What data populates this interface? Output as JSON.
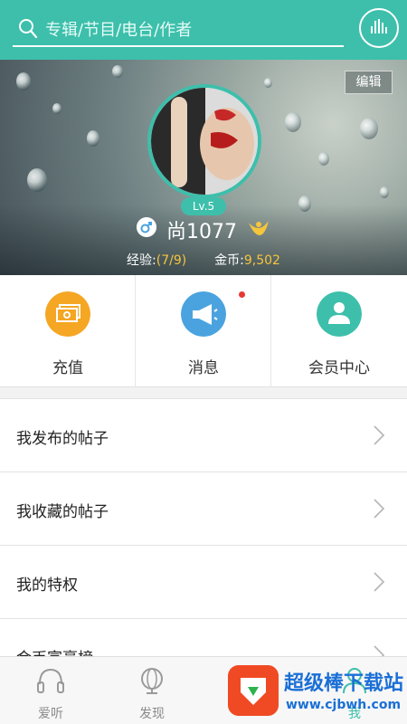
{
  "search": {
    "placeholder": "专辑/节目/电台/作者"
  },
  "profile": {
    "edit_label": "编辑",
    "level": "Lv.5",
    "username": "尚1077",
    "exp_label": "经验:",
    "exp_value": "(7/9)",
    "coins_label": "金币:",
    "coins_value": "9,502"
  },
  "actions": [
    {
      "label": "充值",
      "color": "#f5a623"
    },
    {
      "label": "消息",
      "color": "#4aa3df"
    },
    {
      "label": "会员中心",
      "color": "#3dbfab"
    }
  ],
  "list": [
    {
      "label": "我发布的帖子"
    },
    {
      "label": "我收藏的帖子"
    },
    {
      "label": "我的特权"
    },
    {
      "label": "金币富豪榜"
    }
  ],
  "bottom_nav": [
    {
      "label": "爱听"
    },
    {
      "label": "发现"
    },
    {
      "label": "我"
    }
  ],
  "watermark": {
    "title": "超级棒下载站",
    "url": "www.cjbwh.com"
  },
  "colors": {
    "accent": "#3dbfab",
    "coin": "#f5c53c",
    "badge": "#e53935"
  }
}
